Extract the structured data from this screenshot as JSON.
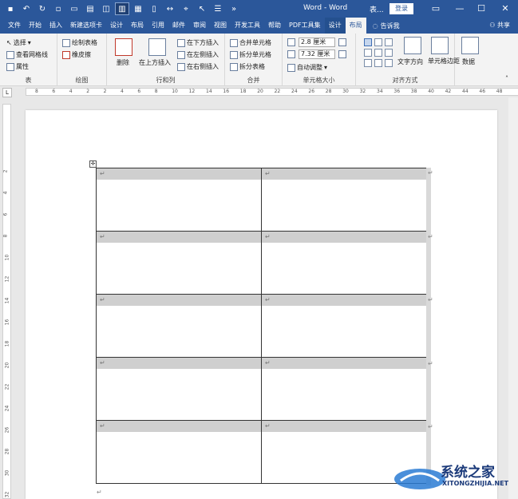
{
  "titlebar": {
    "title": "Word - Word",
    "table_tools": "表...",
    "login": "登录",
    "controls": [
      "▭",
      "—",
      "☐",
      "✕"
    ]
  },
  "quick_access": [
    "save-icon",
    "undo-icon",
    "redo-icon",
    "new-doc-icon",
    "open-icon",
    "print-icon",
    "preview-icon",
    "page-icon",
    "layout-icon",
    "columns-icon",
    "spacing-icon",
    "select-icon",
    "cursor-icon",
    "bullets-icon",
    "more-icon"
  ],
  "tabs": [
    "文件",
    "开始",
    "插入",
    "新建选项卡",
    "设计",
    "布局",
    "引用",
    "邮件",
    "审阅",
    "视图",
    "开发工具",
    "帮助",
    "PDF工具集",
    "设计",
    "布局"
  ],
  "tab_search": "告诉我",
  "tab_share": "共享",
  "ribbon": {
    "table": {
      "select": "选择",
      "gridlines": "查看网格线",
      "properties": "属性",
      "label": "表"
    },
    "draw": {
      "draw_table": "绘制表格",
      "eraser": "橡皮擦",
      "label": "绘图"
    },
    "rows_cols": {
      "delete": "删除",
      "insert_above": "在上方插入",
      "insert_below": "在下方插入",
      "insert_left": "在左侧插入",
      "insert_right": "在右侧插入",
      "label": "行和列"
    },
    "merge": {
      "merge_cells": "合并单元格",
      "split_cells": "拆分单元格",
      "split_table": "拆分表格",
      "label": "合并"
    },
    "cell_size": {
      "height": "2.8 厘米",
      "width": "7.32 厘米",
      "autofit": "自动调整",
      "label": "单元格大小"
    },
    "alignment": {
      "text_direction": "文字方向",
      "cell_margins": "单元格边距",
      "label": "对齐方式"
    },
    "data": {
      "data": "数据"
    }
  },
  "ruler": {
    "h_numbers": [
      "8",
      "6",
      "4",
      "2",
      "2",
      "4",
      "6",
      "8",
      "10",
      "12",
      "14",
      "16",
      "18",
      "20",
      "22",
      "24",
      "26",
      "28",
      "30",
      "32",
      "34",
      "36",
      "38",
      "40",
      "42",
      "44",
      "46",
      "48"
    ],
    "v_numbers": [
      "2",
      "4",
      "6",
      "8",
      "10",
      "12",
      "14",
      "16",
      "18",
      "20",
      "22",
      "24",
      "26",
      "28",
      "30",
      "32",
      "34"
    ]
  },
  "document": {
    "cell_mark": "↵",
    "rows": 5,
    "cols": 2
  },
  "watermark": {
    "title": "系统之家",
    "sub": "XITONGZHIJIA.NET"
  },
  "colors": {
    "accent": "#2b579a",
    "cell_head": "#cfcfcf"
  }
}
